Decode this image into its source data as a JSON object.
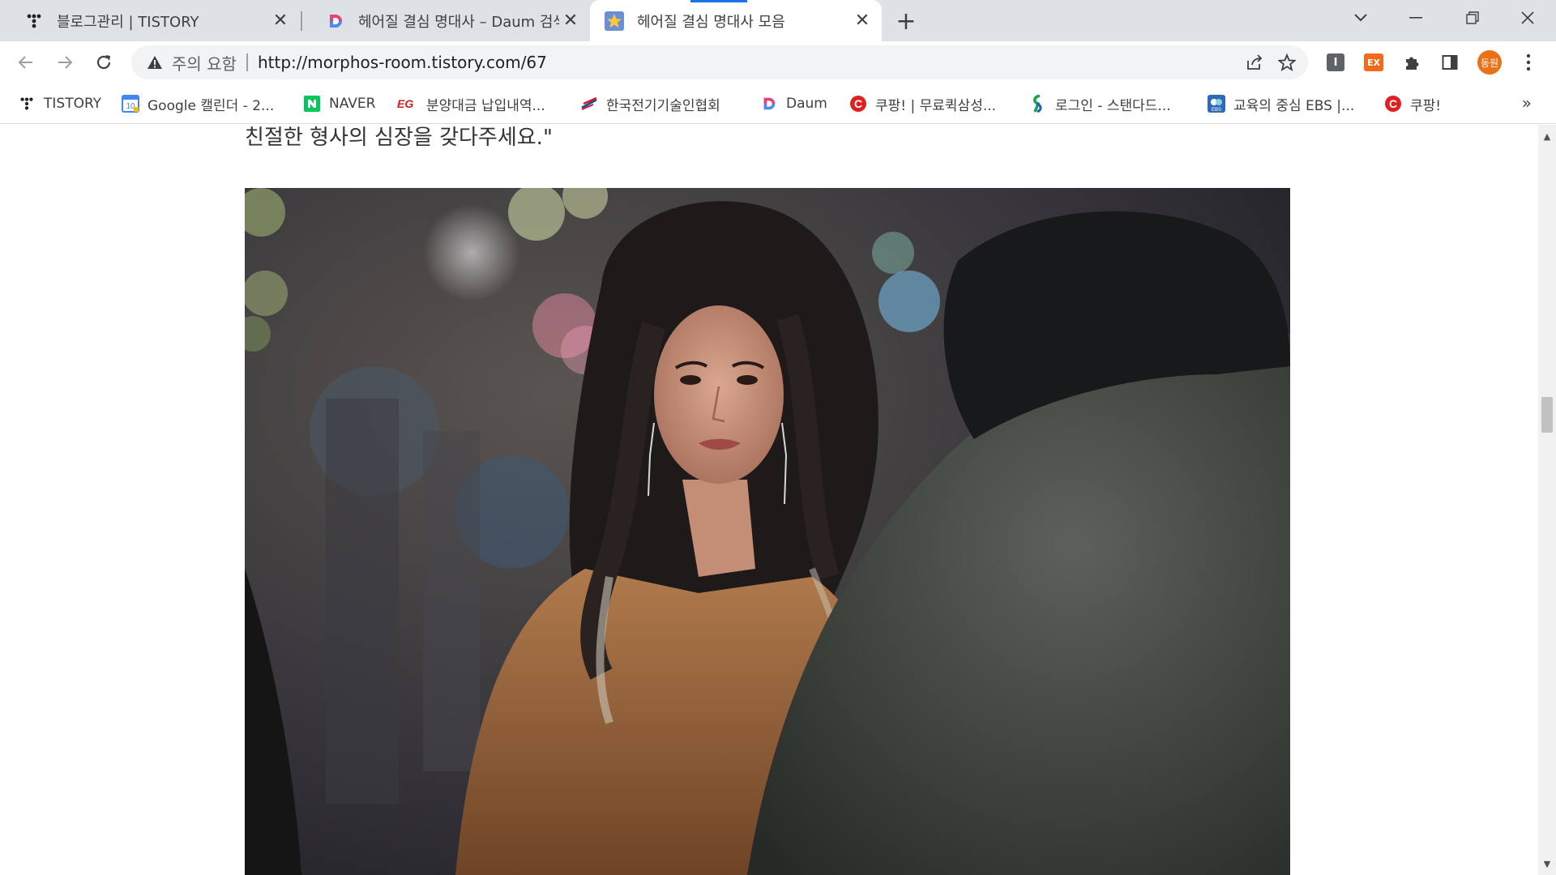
{
  "tabs": [
    {
      "title": "블로그관리 | TISTORY",
      "favicon": "tistory-icon",
      "active": false
    },
    {
      "title": "헤어질 결심 명대사 – Daum 검색",
      "favicon": "daum-icon",
      "active": false
    },
    {
      "title": "헤어질 결심 명대사 모음",
      "favicon": "star-icon",
      "active": true
    }
  ],
  "window_controls": {
    "tab_search": "⌵",
    "minimize": "—",
    "restore": "❐",
    "close": "✕"
  },
  "address_bar": {
    "security_status": "주의 요함",
    "url": "http://morphos-room.tistory.com/67"
  },
  "extensions": {
    "ext1": "I",
    "ext2": "EX",
    "profile": "동원"
  },
  "bookmarks": [
    {
      "label": "TISTORY",
      "icon": "tistory-icon"
    },
    {
      "label": "Google 캘린더 - 2...",
      "icon": "google-calendar-icon"
    },
    {
      "label": "NAVER",
      "icon": "naver-icon"
    },
    {
      "label": "분양대금 납입내역...",
      "icon": "eg-icon"
    },
    {
      "label": "한국전기기술인협회",
      "icon": "kea-icon"
    },
    {
      "label": "Daum",
      "icon": "daum-icon"
    },
    {
      "label": "쿠팡! | 무료퀵삼성...",
      "icon": "coupang-icon"
    },
    {
      "label": "로그인 - 스탠다드...",
      "icon": "standard-chartered-icon"
    },
    {
      "label": "교육의 중심 EBS |...",
      "icon": "ebs-icon"
    },
    {
      "label": "쿠팡!",
      "icon": "coupang-icon"
    }
  ],
  "bookmarks_more": "»",
  "article": {
    "quote_line": "친절한 형사의 심장을 갖다주세요.\""
  },
  "colors": {
    "accent": "#1a73e8",
    "tabstrip": "#dee1e6",
    "profile": "#e8711a"
  }
}
